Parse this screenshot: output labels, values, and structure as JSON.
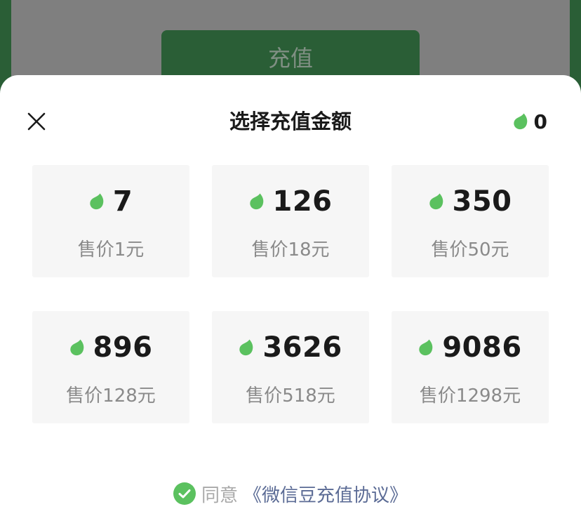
{
  "background": {
    "recharge_button_label": "充值"
  },
  "sheet": {
    "title": "选择充值金额",
    "balance": "0"
  },
  "options": [
    {
      "amount": "7",
      "price": "售价1元"
    },
    {
      "amount": "126",
      "price": "售价18元"
    },
    {
      "amount": "350",
      "price": "售价50元"
    },
    {
      "amount": "896",
      "price": "售价128元"
    },
    {
      "amount": "3626",
      "price": "售价518元"
    },
    {
      "amount": "9086",
      "price": "售价1298元"
    }
  ],
  "agreement": {
    "agree_text": "同意",
    "link_text": "《微信豆充值协议》",
    "checked": true
  },
  "colors": {
    "accent_green": "#5bc15f",
    "backdrop_green": "#2a5e36",
    "link_blue": "#5b6b95"
  },
  "icons": {
    "bean": "wechat-bean-icon",
    "close": "close-icon",
    "check": "check-circle-icon"
  }
}
